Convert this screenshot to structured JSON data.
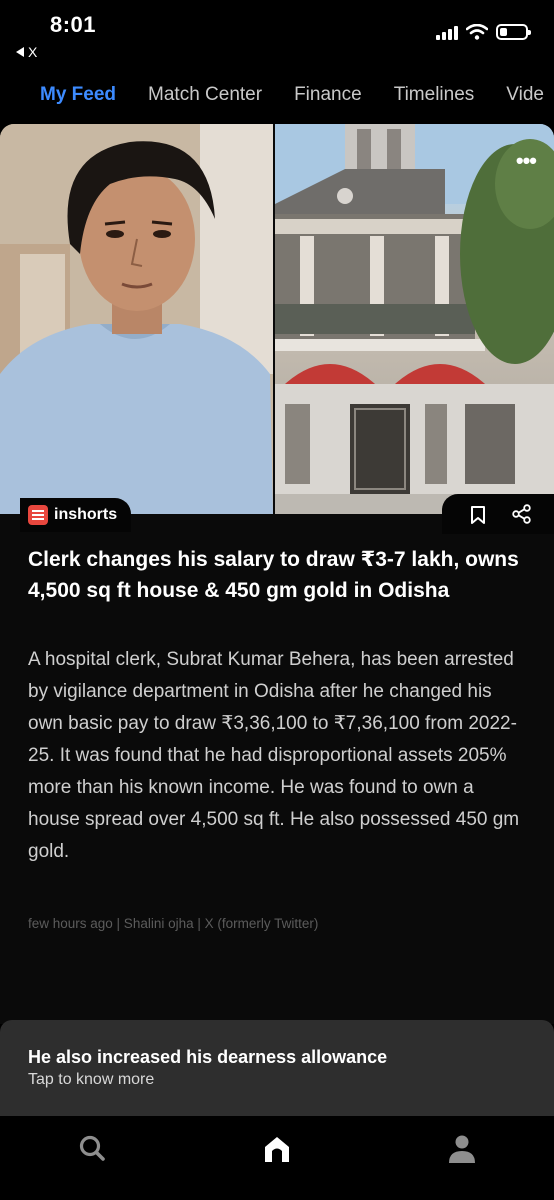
{
  "status_bar": {
    "time": "8:01",
    "back_app_label": "X",
    "battery_level": 0.3
  },
  "tabs": [
    {
      "label": "My Feed",
      "active": true
    },
    {
      "label": "Match Center",
      "active": false
    },
    {
      "label": "Finance",
      "active": false
    },
    {
      "label": "Timelines",
      "active": false
    },
    {
      "label": "Vide",
      "active": false
    }
  ],
  "article": {
    "source_brand": "inshorts",
    "headline": "Clerk changes his salary to draw ₹3-7 lakh, owns 4,500 sq ft house & 450 gm gold in Odisha",
    "body": "A hospital clerk, Subrat Kumar Behera, has been arrested by vigilance department in Odisha after he changed his own basic pay to draw ₹3,36,100 to ₹7,36,100 from 2022-25. It was found that he had disproportional assets 205% more than his known income. He was found to own a house spread over 4,500 sq ft. He also possessed 450 gm gold.",
    "meta": "few hours ago | Shalini ojha | X (formerly Twitter)",
    "menu_icon": "more-dots-icon",
    "bookmark_icon": "bookmark-icon",
    "share_icon": "share-icon"
  },
  "banner": {
    "title": "He also increased his dearness allowance",
    "subtitle": "Tap to know more"
  },
  "bottom_nav": [
    {
      "icon": "search-icon"
    },
    {
      "icon": "home-icon",
      "active": true
    },
    {
      "icon": "profile-icon"
    }
  ],
  "colors": {
    "accent": "#3d8bff",
    "brand": "#e8473e",
    "background": "#000000",
    "banner": "#2e2e2e"
  }
}
